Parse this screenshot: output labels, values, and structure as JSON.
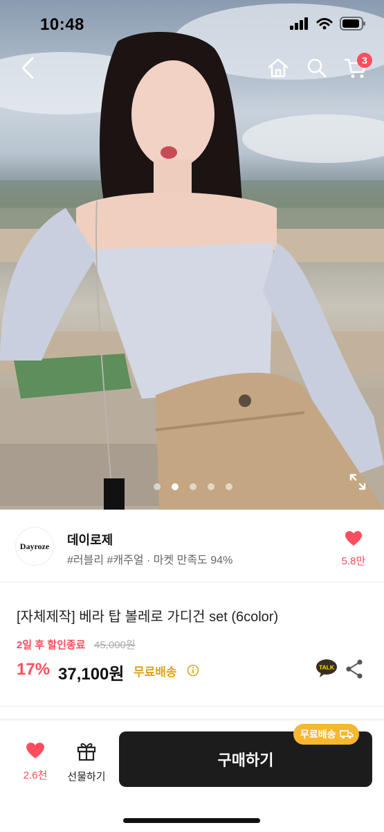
{
  "status_bar": {
    "time": "10:48"
  },
  "hero": {
    "cart_badge_count": "3",
    "carousel_dots": 5,
    "carousel_active_index": 1
  },
  "seller": {
    "logo_text": "Dayroze",
    "name": "데이로제",
    "tags": "#러블리 #캐주얼 · 마켓 만족도 94%",
    "like_count": "5.8만"
  },
  "product": {
    "title": "[자체제작] 베라 탑 볼레로 가디건 set (6color)",
    "deadline": "2일 후 할인종료",
    "original_price": "45,000원",
    "discount": "17%",
    "price": "37,100원",
    "free_shipping": "무료배송",
    "talk_label": "TALK"
  },
  "bottom_bar": {
    "like_count": "2.6천",
    "gift_label": "선물하기",
    "buy_label": "구매하기",
    "ship_tag": "무료배송"
  },
  "colors": {
    "accent_red": "#ff4d5e",
    "free_ship_gold": "#e0a21a",
    "buy_button": "#1c1c1c",
    "ship_tag_bg": "#f7b731"
  },
  "icons": [
    "back-arrow-icon",
    "home-icon",
    "search-icon",
    "cart-icon",
    "expand-icon",
    "heart-icon",
    "info-icon",
    "talk-icon",
    "share-icon",
    "gift-icon",
    "truck-icon"
  ]
}
